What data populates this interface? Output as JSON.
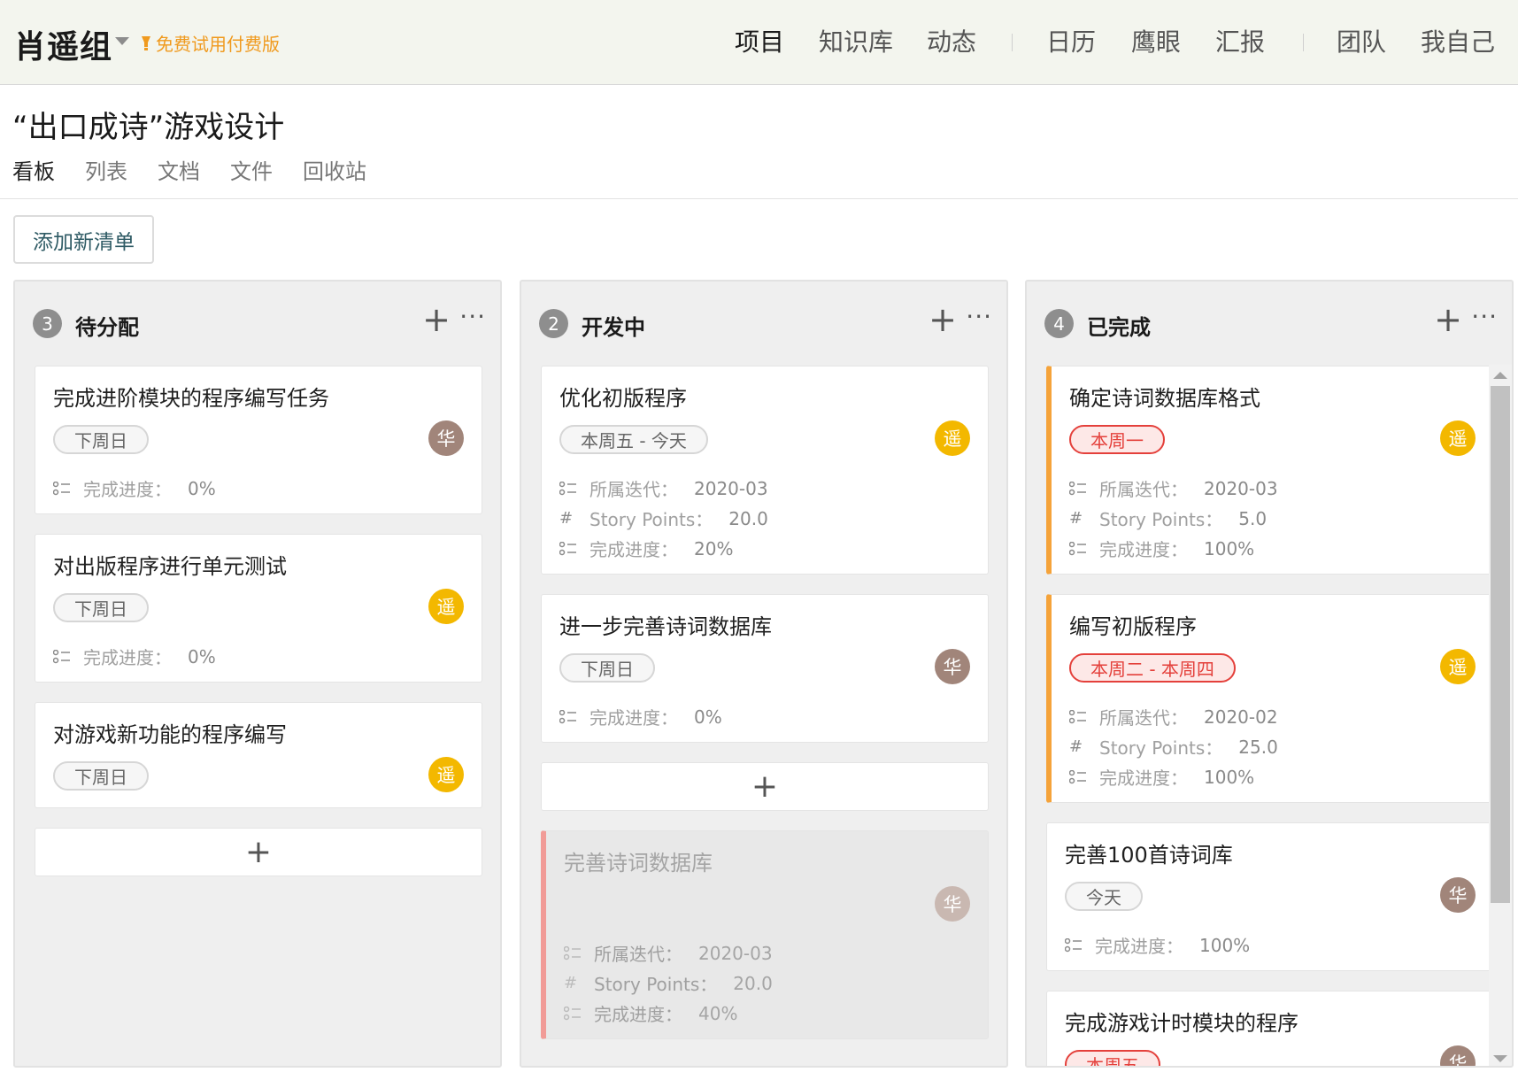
{
  "app": {
    "team_name": "肖遥组",
    "trial_label": "免费试用付费版",
    "nav": [
      "项目",
      "知识库",
      "动态",
      "日历",
      "鹰眼",
      "汇报",
      "团队",
      "我自己"
    ]
  },
  "project": {
    "title": "“出口成诗”游戏设计",
    "tabs": [
      "看板",
      "列表",
      "文档",
      "文件",
      "回收站"
    ],
    "add_list_label": "添加新清单"
  },
  "labels": {
    "progress": "完成进度：",
    "iteration": "所属迭代：",
    "story_points": "Story Points："
  },
  "columns": [
    {
      "count": "3",
      "title": "待分配",
      "cards": [
        {
          "title": "完成进阶模块的程序编写任务",
          "tag": "下周日",
          "avatar": "华",
          "progress": "0%"
        },
        {
          "title": "对出版程序进行单元测试",
          "tag": "下周日",
          "avatar": "遥",
          "progress": "0%"
        },
        {
          "title": "对游戏新功能的程序编写",
          "tag": "下周日",
          "avatar": "遥"
        }
      ]
    },
    {
      "count": "2",
      "title": "开发中",
      "cards": [
        {
          "title": "优化初版程序",
          "tag": "本周五 - 今天",
          "avatar": "遥",
          "iteration": "2020-03",
          "story_points": "20.0",
          "progress": "20%"
        },
        {
          "title": "进一步完善诗词数据库",
          "tag": "下周日",
          "avatar": "华",
          "progress": "0%"
        },
        {
          "title": "完善诗词数据库",
          "avatar": "华",
          "iteration": "2020-03",
          "story_points": "20.0",
          "progress": "40%"
        }
      ]
    },
    {
      "count": "4",
      "title": "已完成",
      "cards": [
        {
          "title": "确定诗词数据库格式",
          "tag": "本周一",
          "avatar": "遥",
          "iteration": "2020-03",
          "story_points": "5.0",
          "progress": "100%"
        },
        {
          "title": "编写初版程序",
          "tag": "本周二 - 本周四",
          "avatar": "遥",
          "iteration": "2020-02",
          "story_points": "25.0",
          "progress": "100%"
        },
        {
          "title": "完善100首诗词库",
          "tag": "今天",
          "avatar": "华",
          "progress": "100%"
        },
        {
          "title": "完成游戏计时模块的程序",
          "tag": "本周五",
          "avatar": "华"
        }
      ]
    }
  ],
  "colors": {
    "accent_orange": "#f5a33a",
    "tag_red": "#e4403b",
    "avatar_hua": "#a1857a",
    "avatar_yao": "#f3b800",
    "trial_orange": "#f09a1e"
  },
  "icons": {
    "progress": "checklist-icon",
    "iteration": "checklist-icon",
    "story_points": "hash-icon",
    "add": "plus-icon",
    "more": "more-icon"
  }
}
